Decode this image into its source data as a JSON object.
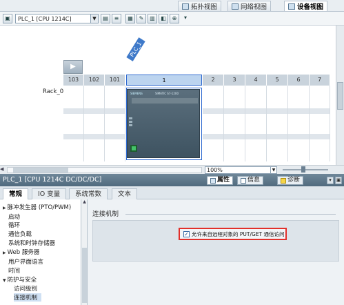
{
  "view_tabs": [
    {
      "label": "拓扑视图",
      "icon": "topology-view-icon",
      "active": false
    },
    {
      "label": "网络视图",
      "icon": "network-view-icon",
      "active": false
    },
    {
      "label": "设备视图",
      "icon": "device-view-icon",
      "active": true
    }
  ],
  "toolbar": {
    "device_selected": "PLC_1 [CPU 1214C]"
  },
  "canvas": {
    "plc_tag": "PLC_1",
    "rack_label": "Rack_0",
    "slots": [
      "103",
      "102",
      "101",
      "1",
      "2",
      "3",
      "4",
      "5",
      "6",
      "7"
    ],
    "selected_slot": "1"
  },
  "zoom": {
    "value": "100%"
  },
  "inspector": {
    "title": "PLC_1 [CPU 1214C DC/DC/DC]",
    "tabs": [
      {
        "label": "属性",
        "icon": "properties-icon"
      },
      {
        "label": "信息",
        "icon": "info-icon"
      },
      {
        "label": "诊断",
        "icon": "diagnostics-icon"
      }
    ],
    "subtabs": [
      "常规",
      "IO 变量",
      "系统常数",
      "文本"
    ],
    "tree": [
      {
        "label": "脉冲发生器 (PTO/PWM)",
        "arrow": true
      },
      {
        "label": "启动"
      },
      {
        "label": "循环"
      },
      {
        "label": "通信负载"
      },
      {
        "label": "系统和时钟存储器"
      },
      {
        "label": "Web 服务器",
        "arrow": true
      },
      {
        "label": "用户界面语言"
      },
      {
        "label": "时间"
      },
      {
        "label": "防护与安全",
        "expanded": true
      },
      {
        "label": "访问级别",
        "child": true
      },
      {
        "label": "连接机制",
        "child": true,
        "selected": true
      }
    ],
    "section_title": "连接机制",
    "option_label": "允许来自远程对象的 PUT/GET 通信访问",
    "option_checked": true
  },
  "colors": {
    "selection_blue": "#2f6ad0",
    "highlight_red": "#e2302b",
    "inspector_header": "#506a7e"
  }
}
